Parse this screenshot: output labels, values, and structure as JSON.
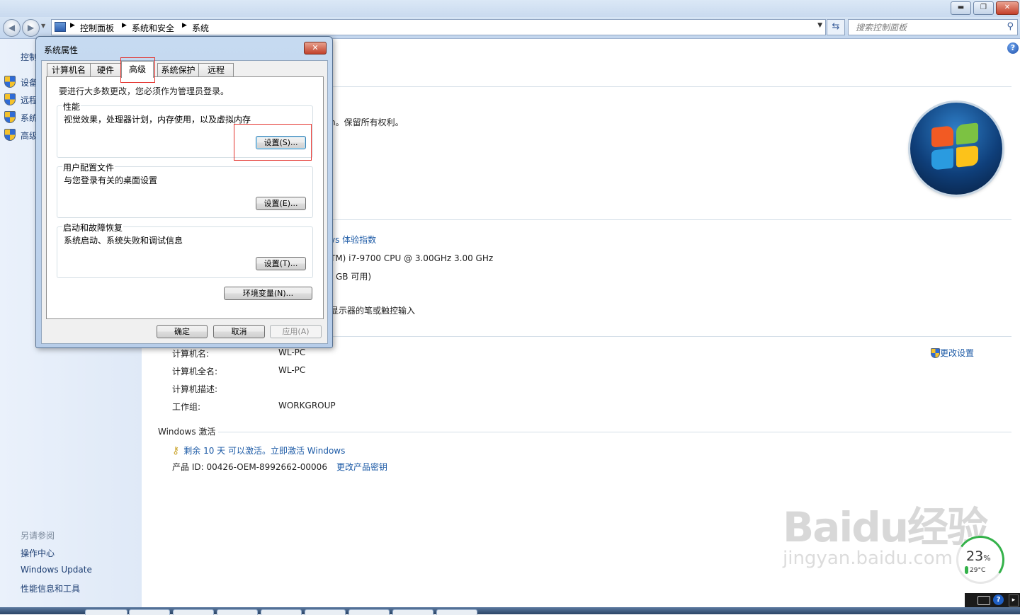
{
  "window": {
    "controls": {
      "minimize": "▬",
      "maximize": "❐",
      "close": "✕"
    }
  },
  "address": {
    "nav_back": "◀",
    "nav_forward": "▶",
    "breadcrumbs": [
      "控制面板",
      "系统和安全",
      "系统"
    ],
    "search_placeholder": "搜索控制面板"
  },
  "left_pane": {
    "home": "控制",
    "tasks": [
      "设备",
      "远程",
      "系统",
      "高级"
    ],
    "see_also_header": "另请参阅",
    "see_also": [
      "操作中心",
      "Windows Update",
      "性能信息和工具"
    ]
  },
  "main": {
    "copyright_fragment": "n。保留所有权利。",
    "experience_index_fragment": "vs 体验指数",
    "processor_fragment": "TM) i7-9700 CPU @ 3.00GHz   3.00 GHz",
    "memory_fragment": "GB 可用)",
    "pen_fragment": "显示器的笔或触控输入",
    "computer": {
      "rows": [
        {
          "label": "计算机名:",
          "value": "WL-PC"
        },
        {
          "label": "计算机全名:",
          "value": "WL-PC"
        },
        {
          "label": "计算机描述:",
          "value": ""
        },
        {
          "label": "工作组:",
          "value": "WORKGROUP"
        }
      ],
      "change_settings": "更改设置"
    },
    "activation": {
      "header": "Windows 激活",
      "status_link": "剩余 10 天 可以激活。立即激活 Windows",
      "product_id": "产品 ID: 00426-OEM-8992662-00006",
      "change_key": "更改产品密钥"
    }
  },
  "dialog": {
    "title": "系统属性",
    "close": "✕",
    "tabs": [
      "计算机名",
      "硬件",
      "高级",
      "系统保护",
      "远程"
    ],
    "active_tab": "高级",
    "admin_note": "要进行大多数更改，您必须作为管理员登录。",
    "sections": [
      {
        "title": "性能",
        "desc": "视觉效果，处理器计划，内存使用，以及虚拟内存",
        "button": "设置(S)..."
      },
      {
        "title": "用户配置文件",
        "desc": "与您登录有关的桌面设置",
        "button": "设置(E)..."
      },
      {
        "title": "启动和故障恢复",
        "desc": "系统启动、系统失败和调试信息",
        "button": "设置(T)..."
      }
    ],
    "env_button": "环境变量(N)...",
    "ok": "确定",
    "cancel": "取消",
    "apply": "应用(A)"
  },
  "overlay": {
    "watermark_logo": "Baidu经验",
    "watermark_url": "jingyan.baidu.com",
    "gauge_percent": "23",
    "gauge_unit": "%",
    "gauge_temp": "29°C"
  },
  "tray": {
    "help": "?",
    "expand": "▸"
  },
  "colors": {
    "highlight_box": "#e3302b",
    "link": "#1c5aa6",
    "gauge": "#34b24a"
  }
}
